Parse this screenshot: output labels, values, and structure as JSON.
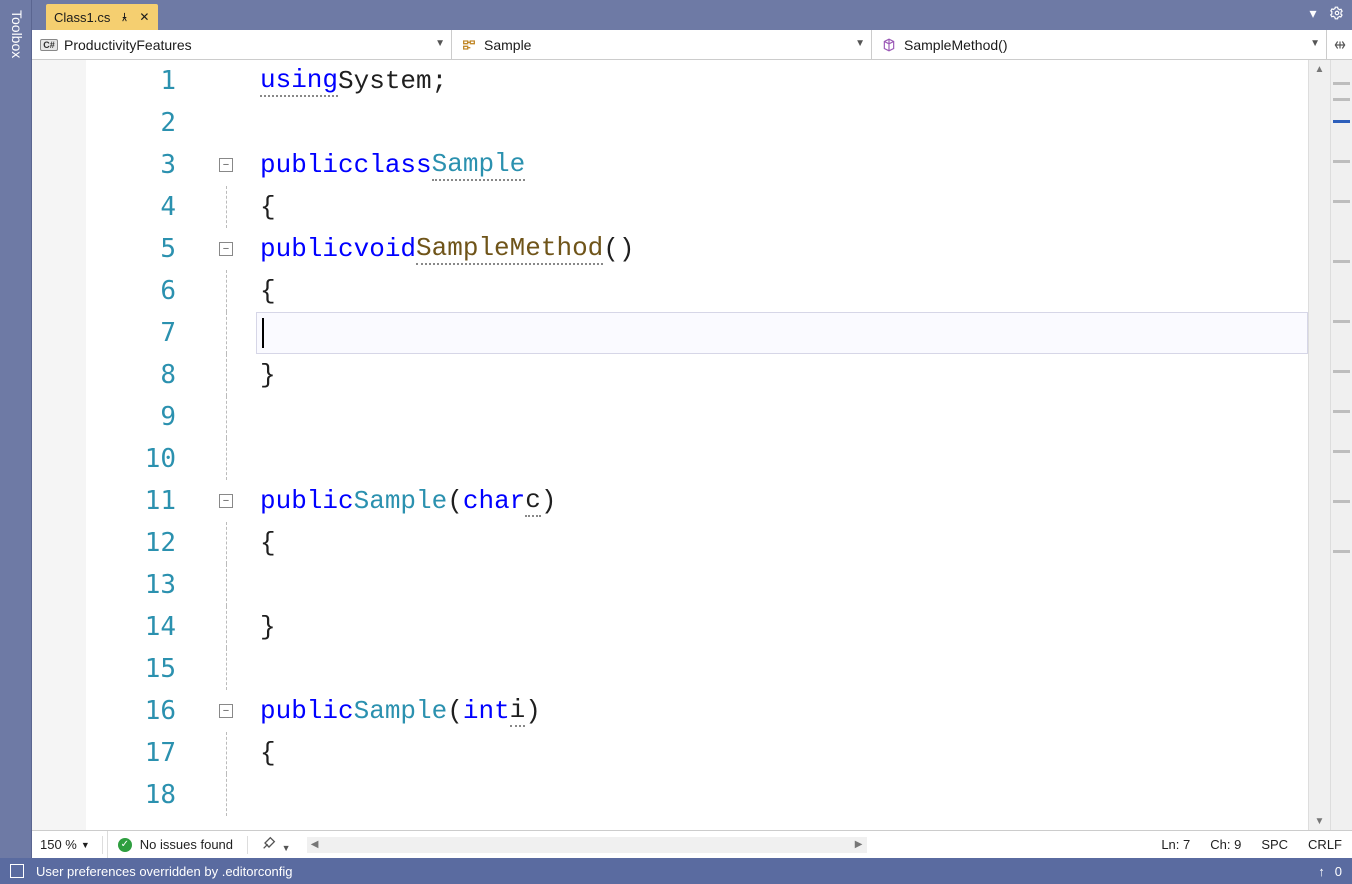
{
  "toolbox": {
    "label": "Toolbox"
  },
  "tab": {
    "filename": "Class1.cs"
  },
  "nav": {
    "project": "ProductivityFeatures",
    "type": "Sample",
    "member": "SampleMethod()"
  },
  "lines": [
    "1",
    "2",
    "3",
    "4",
    "5",
    "6",
    "7",
    "8",
    "9",
    "10",
    "11",
    "12",
    "13",
    "14",
    "15",
    "16",
    "17",
    "18"
  ],
  "code": {
    "l1": {
      "using": "using",
      "sys": "System",
      "semi": ";"
    },
    "l3": {
      "public": "public",
      "class": "class",
      "name": "Sample"
    },
    "l4": {
      "brace": "{"
    },
    "l5": {
      "public": "public",
      "void": "void",
      "name": "SampleMethod",
      "paren": "()"
    },
    "l6": {
      "brace": "{"
    },
    "l8": {
      "brace": "}"
    },
    "l11": {
      "public": "public",
      "name": "Sample",
      "open": "(",
      "type": "char",
      "param": "c",
      "close": ")"
    },
    "l12": {
      "brace": "{"
    },
    "l14": {
      "brace": "}"
    },
    "l16": {
      "public": "public",
      "name": "Sample",
      "open": "(",
      "type": "int",
      "param": "i",
      "close": ")"
    },
    "l17": {
      "brace": "{"
    }
  },
  "editorStatus": {
    "zoom": "150 %",
    "issues": "No issues found",
    "line": "Ln: 7",
    "col": "Ch: 9",
    "indent": "SPC",
    "eol": "CRLF"
  },
  "appStatus": {
    "message": "User preferences overridden by .editorconfig",
    "count": "0"
  }
}
